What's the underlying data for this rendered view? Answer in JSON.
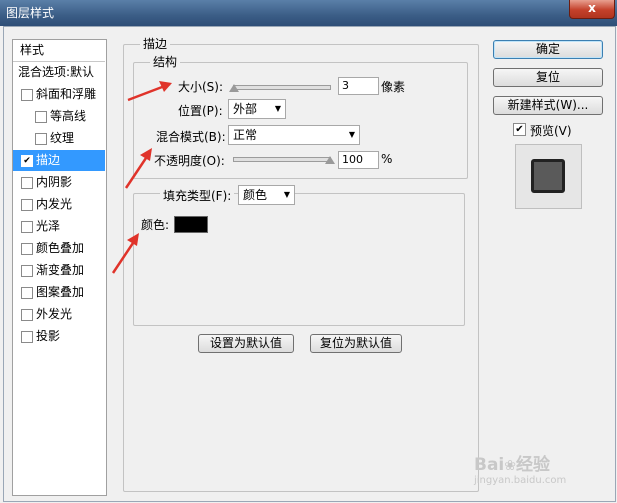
{
  "window": {
    "title": "图层样式",
    "close": "x"
  },
  "sidebar": {
    "header": "样式",
    "items": [
      {
        "label": "混合选项:默认",
        "checkbox": false
      },
      {
        "label": "斜面和浮雕",
        "checkbox": true,
        "checked": false
      },
      {
        "label": "等高线",
        "checkbox": true,
        "checked": false,
        "indent": true
      },
      {
        "label": "纹理",
        "checkbox": true,
        "checked": false,
        "indent": true
      },
      {
        "label": "描边",
        "checkbox": true,
        "checked": true,
        "selected": true
      },
      {
        "label": "内阴影",
        "checkbox": true,
        "checked": false
      },
      {
        "label": "内发光",
        "checkbox": true,
        "checked": false
      },
      {
        "label": "光泽",
        "checkbox": true,
        "checked": false
      },
      {
        "label": "颜色叠加",
        "checkbox": true,
        "checked": false
      },
      {
        "label": "渐变叠加",
        "checkbox": true,
        "checked": false
      },
      {
        "label": "图案叠加",
        "checkbox": true,
        "checked": false
      },
      {
        "label": "外发光",
        "checkbox": true,
        "checked": false
      },
      {
        "label": "投影",
        "checkbox": true,
        "checked": false
      }
    ]
  },
  "stroke": {
    "section_title": "描边",
    "structure_title": "结构",
    "size_label": "大小(S):",
    "size_value": "3",
    "size_unit": "像素",
    "size_slider_fraction": 0.0,
    "position_label": "位置(P):",
    "position_value": "外部",
    "blend_label": "混合模式(B):",
    "blend_value": "正常",
    "opacity_label": "不透明度(O):",
    "opacity_value": "100",
    "opacity_unit": "%",
    "opacity_slider_fraction": 1.0,
    "fill_type_label": "填充类型(F):",
    "fill_type_value": "颜色",
    "color_label": "颜色:",
    "color_value": "#000000"
  },
  "buttons": {
    "ok": "确定",
    "reset": "复位",
    "new_style": "新建样式(W)...",
    "preview_label": "预览(V)",
    "preview_checked": true,
    "set_default": "设置为默认值",
    "reset_default": "复位为默认值"
  },
  "watermark": {
    "text": "Bai",
    "text2": "经验",
    "url": "jingyan.baidu.com"
  },
  "colors": {
    "accent": "#3399ff",
    "annotation": "#e0332a"
  }
}
